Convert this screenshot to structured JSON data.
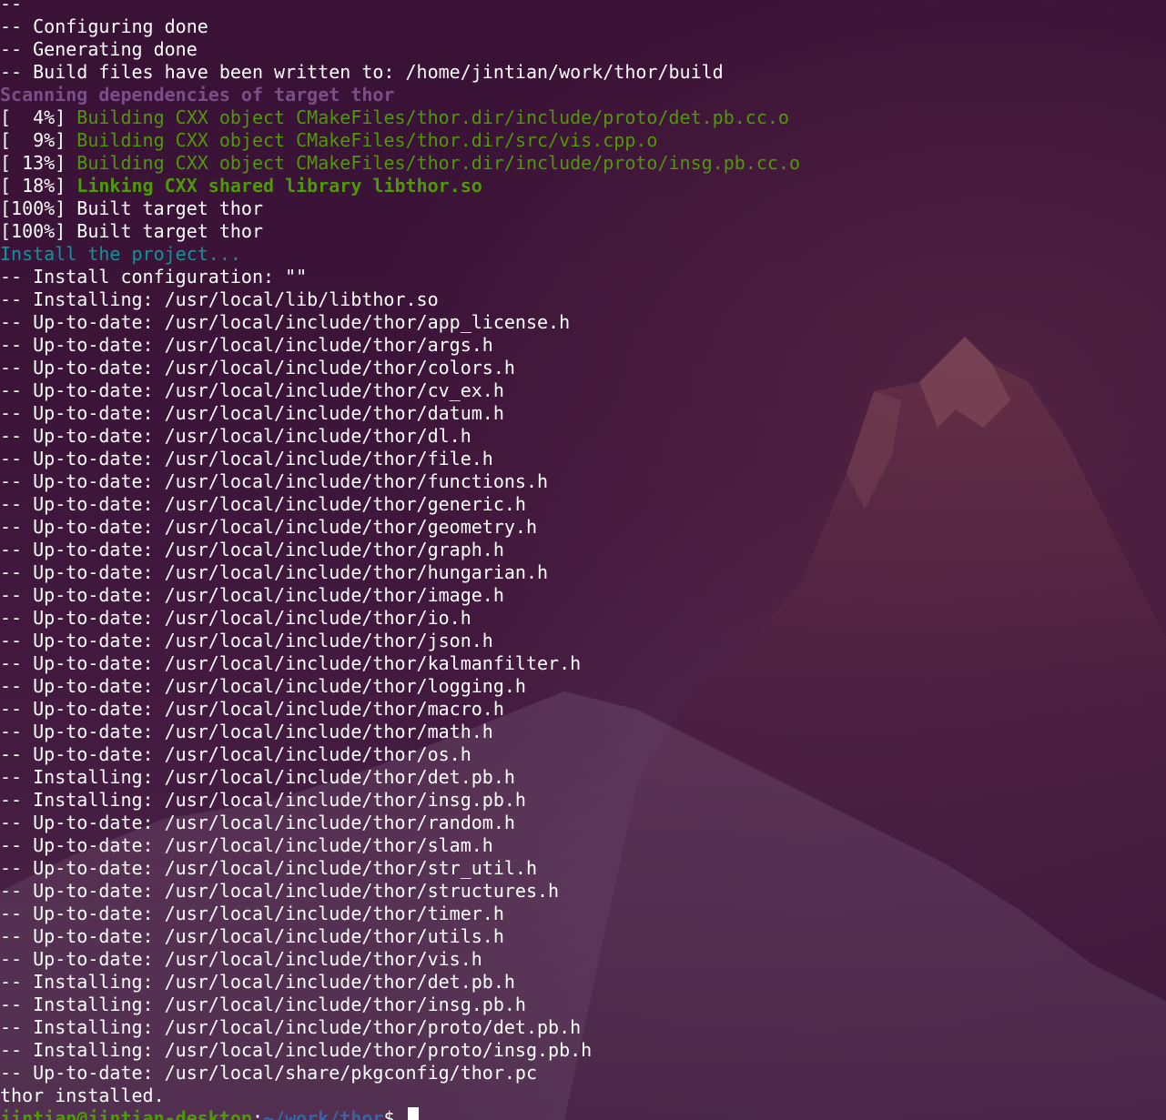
{
  "terminal": {
    "lines": [
      {
        "segments": [
          {
            "text": "-- ",
            "style": "default"
          }
        ]
      },
      {
        "segments": [
          {
            "text": "-- Configuring done",
            "style": "default"
          }
        ]
      },
      {
        "segments": [
          {
            "text": "-- Generating done",
            "style": "default"
          }
        ]
      },
      {
        "segments": [
          {
            "text": "-- Build files have been written to: /home/jintian/work/thor/build",
            "style": "default"
          }
        ]
      },
      {
        "segments": [
          {
            "text": "Scanning dependencies of target thor",
            "style": "magenta"
          }
        ]
      },
      {
        "segments": [
          {
            "text": "[  4%] ",
            "style": "default"
          },
          {
            "text": "Building CXX object CMakeFiles/thor.dir/include/proto/det.pb.cc.o",
            "style": "green-text"
          }
        ]
      },
      {
        "segments": [
          {
            "text": "[  9%] ",
            "style": "default"
          },
          {
            "text": "Building CXX object CMakeFiles/thor.dir/src/vis.cpp.o",
            "style": "green-text"
          }
        ]
      },
      {
        "segments": [
          {
            "text": "[ 13%] ",
            "style": "default"
          },
          {
            "text": "Building CXX object CMakeFiles/thor.dir/include/proto/insg.pb.cc.o",
            "style": "green-text"
          }
        ]
      },
      {
        "segments": [
          {
            "text": "[ 18%] ",
            "style": "default"
          },
          {
            "text": "Linking CXX shared library libthor.so",
            "style": "green-bold"
          }
        ]
      },
      {
        "segments": [
          {
            "text": "[100%] Built target thor",
            "style": "default"
          }
        ]
      },
      {
        "segments": [
          {
            "text": "[100%] Built target thor",
            "style": "default"
          }
        ]
      },
      {
        "segments": [
          {
            "text": "Install the project...",
            "style": "cyan"
          }
        ]
      },
      {
        "segments": [
          {
            "text": "-- Install configuration: \"\"",
            "style": "default"
          }
        ]
      },
      {
        "segments": [
          {
            "text": "-- Installing: /usr/local/lib/libthor.so",
            "style": "default"
          }
        ]
      },
      {
        "segments": [
          {
            "text": "-- Up-to-date: /usr/local/include/thor/app_license.h",
            "style": "default"
          }
        ]
      },
      {
        "segments": [
          {
            "text": "-- Up-to-date: /usr/local/include/thor/args.h",
            "style": "default"
          }
        ]
      },
      {
        "segments": [
          {
            "text": "-- Up-to-date: /usr/local/include/thor/colors.h",
            "style": "default"
          }
        ]
      },
      {
        "segments": [
          {
            "text": "-- Up-to-date: /usr/local/include/thor/cv_ex.h",
            "style": "default"
          }
        ]
      },
      {
        "segments": [
          {
            "text": "-- Up-to-date: /usr/local/include/thor/datum.h",
            "style": "default"
          }
        ]
      },
      {
        "segments": [
          {
            "text": "-- Up-to-date: /usr/local/include/thor/dl.h",
            "style": "default"
          }
        ]
      },
      {
        "segments": [
          {
            "text": "-- Up-to-date: /usr/local/include/thor/file.h",
            "style": "default"
          }
        ]
      },
      {
        "segments": [
          {
            "text": "-- Up-to-date: /usr/local/include/thor/functions.h",
            "style": "default"
          }
        ]
      },
      {
        "segments": [
          {
            "text": "-- Up-to-date: /usr/local/include/thor/generic.h",
            "style": "default"
          }
        ]
      },
      {
        "segments": [
          {
            "text": "-- Up-to-date: /usr/local/include/thor/geometry.h",
            "style": "default"
          }
        ]
      },
      {
        "segments": [
          {
            "text": "-- Up-to-date: /usr/local/include/thor/graph.h",
            "style": "default"
          }
        ]
      },
      {
        "segments": [
          {
            "text": "-- Up-to-date: /usr/local/include/thor/hungarian.h",
            "style": "default"
          }
        ]
      },
      {
        "segments": [
          {
            "text": "-- Up-to-date: /usr/local/include/thor/image.h",
            "style": "default"
          }
        ]
      },
      {
        "segments": [
          {
            "text": "-- Up-to-date: /usr/local/include/thor/io.h",
            "style": "default"
          }
        ]
      },
      {
        "segments": [
          {
            "text": "-- Up-to-date: /usr/local/include/thor/json.h",
            "style": "default"
          }
        ]
      },
      {
        "segments": [
          {
            "text": "-- Up-to-date: /usr/local/include/thor/kalmanfilter.h",
            "style": "default"
          }
        ]
      },
      {
        "segments": [
          {
            "text": "-- Up-to-date: /usr/local/include/thor/logging.h",
            "style": "default"
          }
        ]
      },
      {
        "segments": [
          {
            "text": "-- Up-to-date: /usr/local/include/thor/macro.h",
            "style": "default"
          }
        ]
      },
      {
        "segments": [
          {
            "text": "-- Up-to-date: /usr/local/include/thor/math.h",
            "style": "default"
          }
        ]
      },
      {
        "segments": [
          {
            "text": "-- Up-to-date: /usr/local/include/thor/os.h",
            "style": "default"
          }
        ]
      },
      {
        "segments": [
          {
            "text": "-- Installing: /usr/local/include/thor/det.pb.h",
            "style": "default"
          }
        ]
      },
      {
        "segments": [
          {
            "text": "-- Installing: /usr/local/include/thor/insg.pb.h",
            "style": "default"
          }
        ]
      },
      {
        "segments": [
          {
            "text": "-- Up-to-date: /usr/local/include/thor/random.h",
            "style": "default"
          }
        ]
      },
      {
        "segments": [
          {
            "text": "-- Up-to-date: /usr/local/include/thor/slam.h",
            "style": "default"
          }
        ]
      },
      {
        "segments": [
          {
            "text": "-- Up-to-date: /usr/local/include/thor/str_util.h",
            "style": "default"
          }
        ]
      },
      {
        "segments": [
          {
            "text": "-- Up-to-date: /usr/local/include/thor/structures.h",
            "style": "default"
          }
        ]
      },
      {
        "segments": [
          {
            "text": "-- Up-to-date: /usr/local/include/thor/timer.h",
            "style": "default"
          }
        ]
      },
      {
        "segments": [
          {
            "text": "-- Up-to-date: /usr/local/include/thor/utils.h",
            "style": "default"
          }
        ]
      },
      {
        "segments": [
          {
            "text": "-- Up-to-date: /usr/local/include/thor/vis.h",
            "style": "default"
          }
        ]
      },
      {
        "segments": [
          {
            "text": "-- Installing: /usr/local/include/thor/det.pb.h",
            "style": "default"
          }
        ]
      },
      {
        "segments": [
          {
            "text": "-- Installing: /usr/local/include/thor/insg.pb.h",
            "style": "default"
          }
        ]
      },
      {
        "segments": [
          {
            "text": "-- Installing: /usr/local/include/thor/proto/det.pb.h",
            "style": "default"
          }
        ]
      },
      {
        "segments": [
          {
            "text": "-- Installing: /usr/local/include/thor/proto/insg.pb.h",
            "style": "default"
          }
        ]
      },
      {
        "segments": [
          {
            "text": "-- Up-to-date: /usr/local/share/pkgconfig/thor.pc",
            "style": "default"
          }
        ]
      },
      {
        "segments": [
          {
            "text": "thor installed.",
            "style": "default"
          }
        ]
      }
    ],
    "prompt": {
      "user_host": "jintian@jintian-desktop",
      "separator": ":",
      "path": "~/work/thor",
      "symbol": "$ "
    }
  }
}
